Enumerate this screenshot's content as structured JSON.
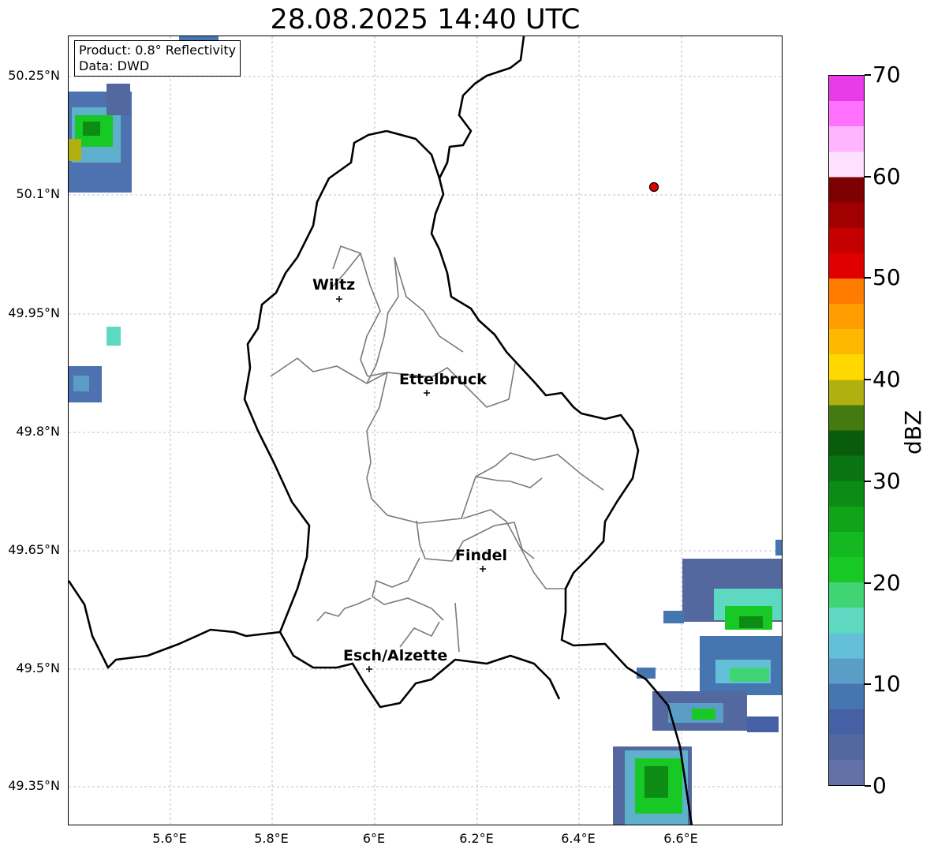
{
  "title": "28.08.2025 14:40 UTC",
  "info": {
    "product": "Product: 0.8° Reflectivity",
    "data": "Data: DWD"
  },
  "map": {
    "lat_ticks": [
      "50.25°N",
      "50.1°N",
      "49.95°N",
      "49.8°N",
      "49.65°N",
      "49.5°N",
      "49.35°N"
    ],
    "lon_ticks": [
      "5.6°E",
      "5.8°E",
      "6°E",
      "6.2°E",
      "6.4°E",
      "6.6°E"
    ],
    "cities": [
      {
        "name": "Wiltz"
      },
      {
        "name": "Ettelbruck"
      },
      {
        "name": "Findel"
      },
      {
        "name": "Esch/Alzette"
      }
    ],
    "radar_marker_color": "#e00000"
  },
  "colorbar": {
    "label": "dBZ",
    "ticks": [
      "0",
      "10",
      "20",
      "30",
      "40",
      "50",
      "60",
      "70"
    ],
    "colors": [
      "#6272a8",
      "#52689e",
      "#4660a6",
      "#4676b0",
      "#5a9ec8",
      "#64c0d8",
      "#5ed8c0",
      "#40d474",
      "#18c824",
      "#14b820",
      "#10a418",
      "#0c8c14",
      "#0a7412",
      "#085c0c",
      "#447a10",
      "#b0b010",
      "#ffd800",
      "#ffb800",
      "#ff9c00",
      "#ff7c00",
      "#e00000",
      "#c40000",
      "#a00000",
      "#7e0000",
      "#ffe0ff",
      "#ffb4ff",
      "#ff70ff",
      "#e83ce8"
    ]
  }
}
